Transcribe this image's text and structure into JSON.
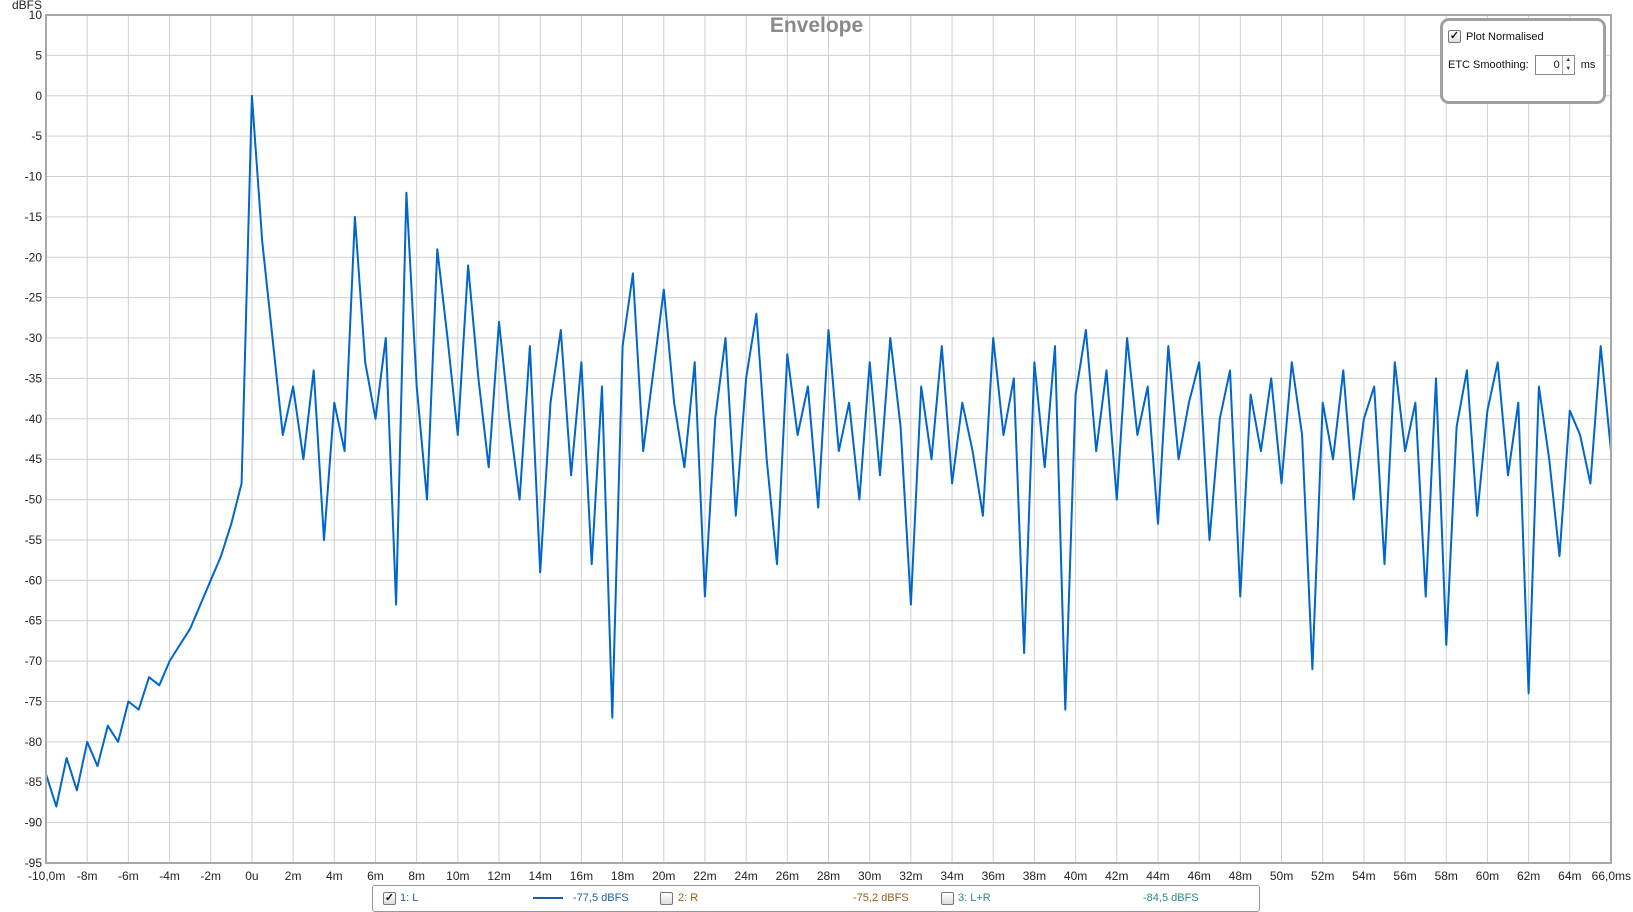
{
  "chart_data": {
    "type": "line",
    "title": "Envelope",
    "xlabel": "",
    "ylabel": "dBFS",
    "xlim": [
      -10,
      66
    ],
    "ylim": [
      -95,
      10
    ],
    "grid": true,
    "x_unit": "ms",
    "x_start": -10,
    "x_step": 0.5,
    "x_ticks": [
      {
        "v": -10,
        "label": "-10,0m"
      },
      {
        "v": -8,
        "label": "-8m"
      },
      {
        "v": -6,
        "label": "-6m"
      },
      {
        "v": -4,
        "label": "-4m"
      },
      {
        "v": -2,
        "label": "-2m"
      },
      {
        "v": 0,
        "label": "0u"
      },
      {
        "v": 2,
        "label": "2m"
      },
      {
        "v": 4,
        "label": "4m"
      },
      {
        "v": 6,
        "label": "6m"
      },
      {
        "v": 8,
        "label": "8m"
      },
      {
        "v": 10,
        "label": "10m"
      },
      {
        "v": 12,
        "label": "12m"
      },
      {
        "v": 14,
        "label": "14m"
      },
      {
        "v": 16,
        "label": "16m"
      },
      {
        "v": 18,
        "label": "18m"
      },
      {
        "v": 20,
        "label": "20m"
      },
      {
        "v": 22,
        "label": "22m"
      },
      {
        "v": 24,
        "label": "24m"
      },
      {
        "v": 26,
        "label": "26m"
      },
      {
        "v": 28,
        "label": "28m"
      },
      {
        "v": 30,
        "label": "30m"
      },
      {
        "v": 32,
        "label": "32m"
      },
      {
        "v": 34,
        "label": "34m"
      },
      {
        "v": 36,
        "label": "36m"
      },
      {
        "v": 38,
        "label": "38m"
      },
      {
        "v": 40,
        "label": "40m"
      },
      {
        "v": 42,
        "label": "42m"
      },
      {
        "v": 44,
        "label": "44m"
      },
      {
        "v": 46,
        "label": "46m"
      },
      {
        "v": 48,
        "label": "48m"
      },
      {
        "v": 50,
        "label": "50m"
      },
      {
        "v": 52,
        "label": "52m"
      },
      {
        "v": 54,
        "label": "54m"
      },
      {
        "v": 56,
        "label": "56m"
      },
      {
        "v": 58,
        "label": "58m"
      },
      {
        "v": 60,
        "label": "60m"
      },
      {
        "v": 62,
        "label": "62m"
      },
      {
        "v": 64,
        "label": "64m"
      },
      {
        "v": 66,
        "label": "66,0ms"
      }
    ],
    "y_ticks": [
      10,
      5,
      0,
      -5,
      -10,
      -15,
      -20,
      -25,
      -30,
      -35,
      -40,
      -45,
      -50,
      -55,
      -60,
      -65,
      -70,
      -75,
      -80,
      -85,
      -90,
      -95
    ],
    "series": [
      {
        "name": "1: L",
        "color": "#0066cc",
        "values": [
          -84,
          -88,
          -82,
          -86,
          -80,
          -83,
          -78,
          -80,
          -75,
          -76,
          -72,
          -73,
          -70,
          -68,
          -66,
          -63,
          -60,
          -57,
          -53,
          -48,
          0,
          -18,
          -30,
          -42,
          -36,
          -45,
          -34,
          -55,
          -38,
          -44,
          -15,
          -33,
          -40,
          -30,
          -63,
          -12,
          -36,
          -50,
          -19,
          -30,
          -42,
          -21,
          -35,
          -46,
          -28,
          -40,
          -50,
          -31,
          -59,
          -38,
          -29,
          -47,
          -33,
          -58,
          -36,
          -77,
          -31,
          -22,
          -44,
          -34,
          -24,
          -38,
          -46,
          -33,
          -62,
          -40,
          -30,
          -52,
          -35,
          -27,
          -45,
          -58,
          -32,
          -42,
          -36,
          -51,
          -29,
          -44,
          -38,
          -50,
          -33,
          -47,
          -30,
          -41,
          -63,
          -36,
          -45,
          -31,
          -48,
          -38,
          -44,
          -52,
          -30,
          -42,
          -35,
          -69,
          -33,
          -46,
          -31,
          -76,
          -37,
          -29,
          -44,
          -34,
          -50,
          -30,
          -42,
          -36,
          -53,
          -31,
          -45,
          -38,
          -33,
          -55,
          -40,
          -34,
          -62,
          -37,
          -44,
          -35,
          -48,
          -33,
          -42,
          -71,
          -38,
          -45,
          -34,
          -50,
          -40,
          -36,
          -58,
          -33,
          -44,
          -38,
          -62,
          -35,
          -68,
          -41,
          -34,
          -52,
          -39,
          -33,
          -47,
          -38,
          -74,
          -36,
          -45,
          -57,
          -39,
          -42,
          -48,
          -31,
          -44
        ]
      }
    ]
  },
  "panel": {
    "plot_normalised_label": "Plot Normalised",
    "plot_normalised_checked": true,
    "etc_smoothing_label": "ETC Smoothing:",
    "etc_smoothing_value": "0",
    "etc_smoothing_unit": "ms"
  },
  "legend": {
    "items": [
      {
        "label": "1: L",
        "value": "-77,5 dBFS",
        "checked": true,
        "color": "#1f5fa8"
      },
      {
        "label": "2: R",
        "value": "-75,2 dBFS",
        "checked": false,
        "color": "#9a5a10"
      },
      {
        "label": "3: L+R",
        "value": "-84,5 dBFS",
        "checked": false,
        "color": "#2a8a8a"
      }
    ]
  }
}
